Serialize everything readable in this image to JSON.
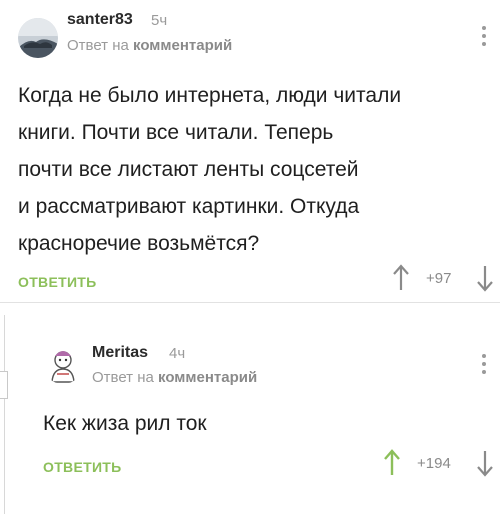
{
  "comments": [
    {
      "username": "santer83",
      "time": "5ч",
      "reply_prefix": "Ответ на",
      "reply_link": "комментарий",
      "body_lines": [
        "Когда не было интернета, люди читали",
        "книги. Почти все читали. Теперь",
        "почти все листают ленты соцсетей",
        "и рассматривают картинки. Откуда",
        "красноречие возьмётся?"
      ],
      "reply_label": "ОТВЕТИТЬ",
      "rating": "+97"
    },
    {
      "username": "Meritas",
      "time": "4ч",
      "reply_prefix": "Ответ на",
      "reply_link": "комментарий",
      "body_lines": [
        "Кек жиза рил ток"
      ],
      "reply_label": "ОТВЕТИТЬ",
      "rating": "+194"
    }
  ],
  "colors": {
    "reply_button": "#8cbf5a",
    "upvote_active": "#8cbf5a",
    "arrow_neutral": "#8a8a8a",
    "meta_text": "#9a9a9a"
  },
  "icons": {
    "upvote": "arrow-up-icon",
    "downvote": "arrow-down-icon",
    "menu": "more-vertical-icon"
  }
}
